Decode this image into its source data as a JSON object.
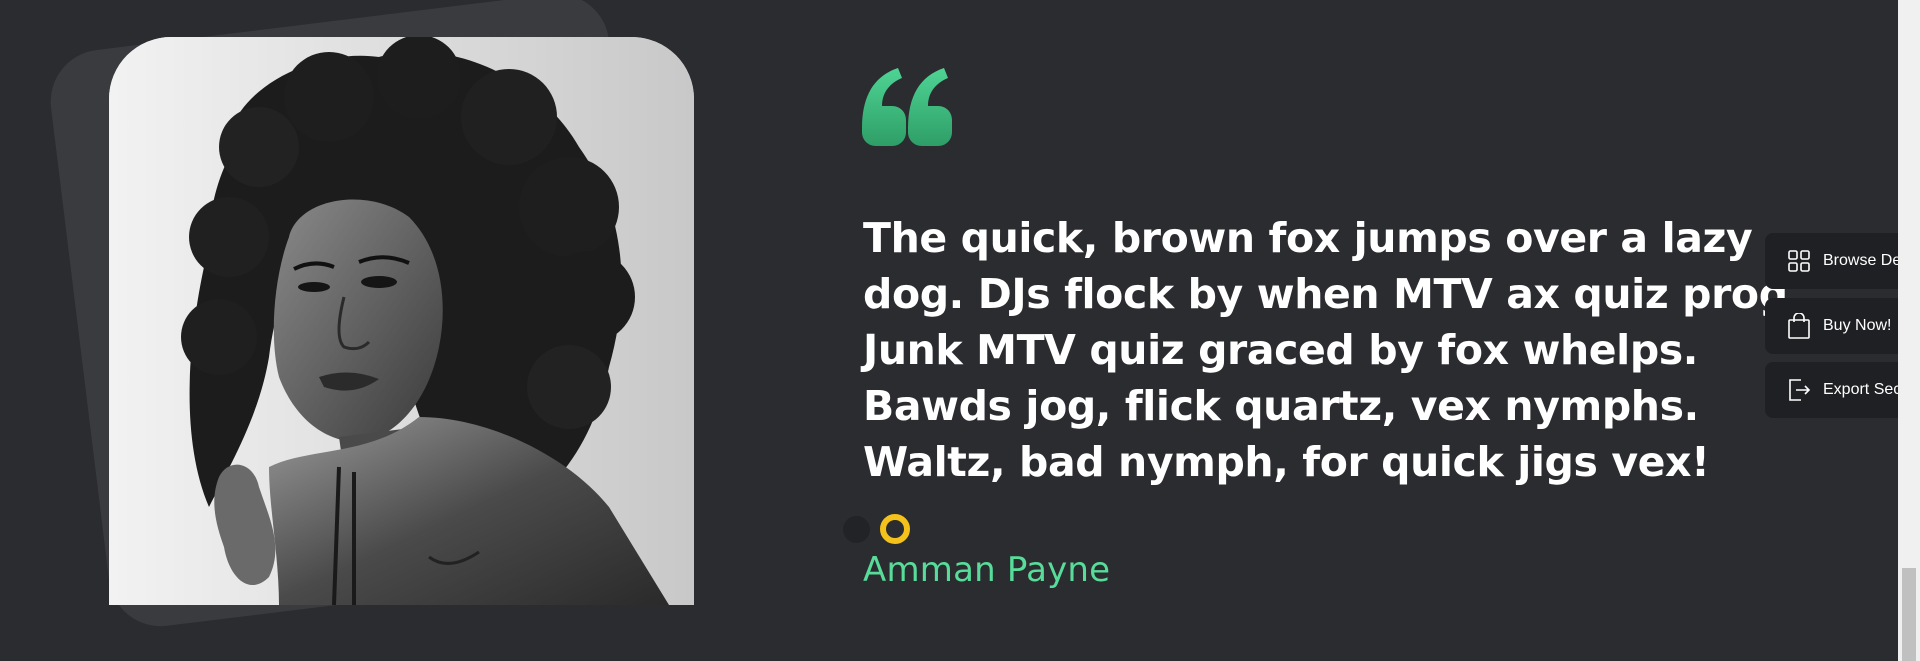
{
  "testimonial": {
    "quote": "The quick, brown fox jumps over a lazy dog. DJs flock by when MTV ax quiz prog. Junk MTV quiz graced by fox whelps. Bawds jog, flick quartz, vex nymphs. Waltz, bad nymph, for quick jigs vex!",
    "author": "Amman Payne",
    "photo_alt": "black-and-white portrait of a woman",
    "quote_icon": "quote-icon",
    "quote_color": "#3bbf7d",
    "author_color": "#58dc9a",
    "active_dot_color": "#f4c21a",
    "slides": [
      {
        "active": false
      },
      {
        "active": true
      }
    ]
  },
  "side_buttons": [
    {
      "label": "Browse De",
      "icon": "grid-icon"
    },
    {
      "label": "Buy Now!",
      "icon": "shopping-bag-icon"
    },
    {
      "label": "Export Sec",
      "icon": "export-icon"
    }
  ],
  "colors": {
    "background": "#2b2c30",
    "side_button_bg": "#1f2023"
  }
}
